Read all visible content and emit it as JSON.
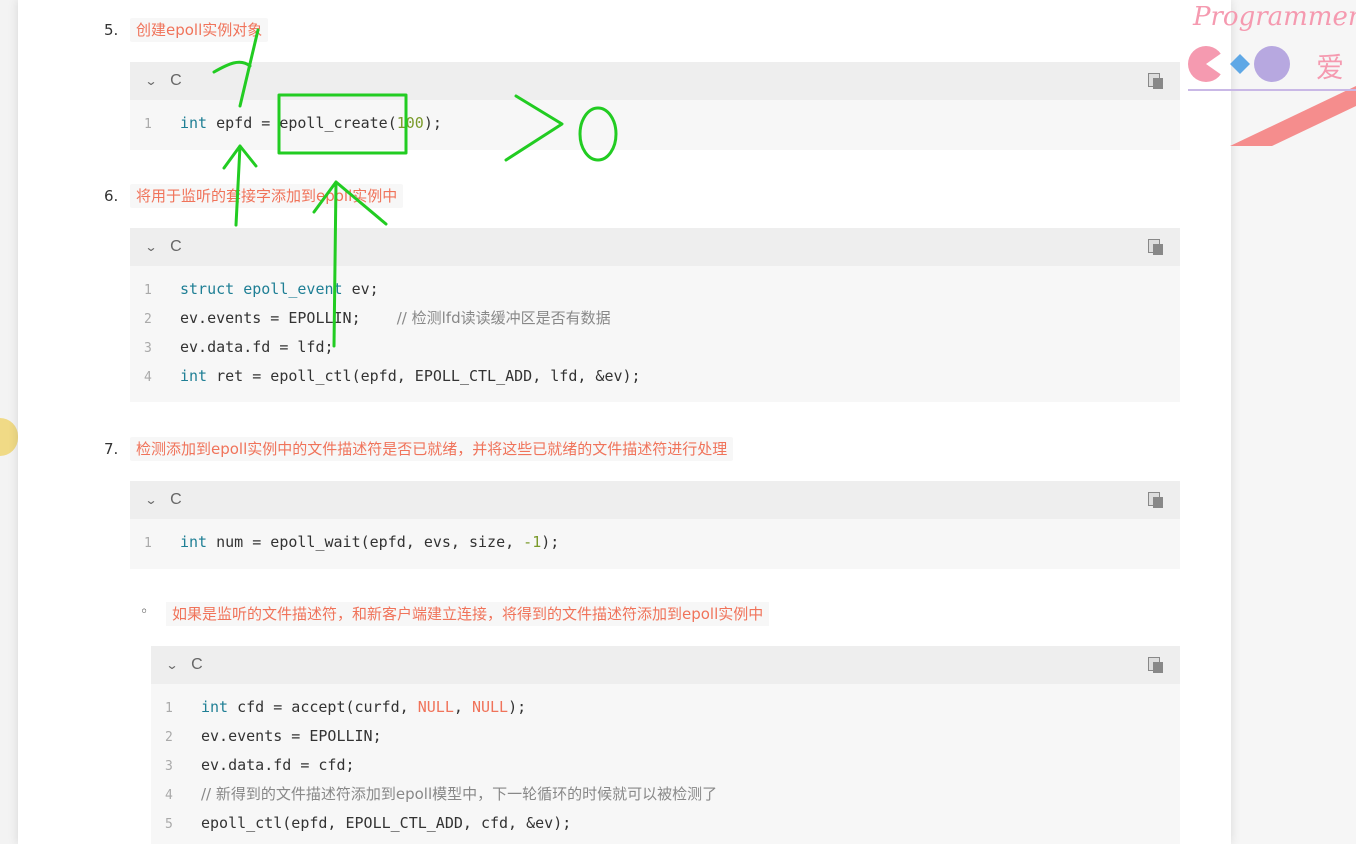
{
  "steps": [
    {
      "num": "5.",
      "label": "创建epoll实例对象"
    },
    {
      "num": "6.",
      "label": "将用于监听的套接字添加到epoll实例中"
    },
    {
      "num": "7.",
      "label": "检测添加到epoll实例中的文件描述符是否已就绪，并将这些已就绪的文件描述符进行处理"
    }
  ],
  "bullet": {
    "marker": "◦",
    "label": "如果是监听的文件描述符，和新客户端建立连接，将得到的文件描述符添加到epoll实例中"
  },
  "code_blocks": [
    {
      "language": "C",
      "lines": [
        {
          "n": "1",
          "tokens": [
            {
              "t": "int",
              "c": "kw"
            },
            {
              "t": " epfd = epoll_create(",
              "c": ""
            },
            {
              "t": "100",
              "c": "num-lit"
            },
            {
              "t": ");",
              "c": ""
            }
          ]
        }
      ]
    },
    {
      "language": "C",
      "lines": [
        {
          "n": "1",
          "tokens": [
            {
              "t": "struct",
              "c": "kw"
            },
            {
              "t": " ",
              "c": ""
            },
            {
              "t": "epoll_event",
              "c": "kw"
            },
            {
              "t": " ev;",
              "c": ""
            }
          ]
        },
        {
          "n": "2",
          "tokens": [
            {
              "t": "ev.events = EPOLLIN;    ",
              "c": ""
            },
            {
              "t": "// 检测lfd读读缓冲区是否有数据",
              "c": "cmt"
            }
          ]
        },
        {
          "n": "3",
          "tokens": [
            {
              "t": "ev.data.fd = lfd;",
              "c": ""
            }
          ]
        },
        {
          "n": "4",
          "tokens": [
            {
              "t": "int",
              "c": "kw"
            },
            {
              "t": " ret = epoll_ctl(epfd, EPOLL_CTL_ADD, lfd, &ev);",
              "c": ""
            }
          ]
        }
      ]
    },
    {
      "language": "C",
      "lines": [
        {
          "n": "1",
          "tokens": [
            {
              "t": "int",
              "c": "kw"
            },
            {
              "t": " num = epoll_wait(epfd, evs, size, ",
              "c": ""
            },
            {
              "t": "-1",
              "c": "num-lit"
            },
            {
              "t": ");",
              "c": ""
            }
          ]
        }
      ]
    },
    {
      "language": "C",
      "lines": [
        {
          "n": "1",
          "tokens": [
            {
              "t": "int",
              "c": "kw"
            },
            {
              "t": " cfd = accept(curfd, ",
              "c": ""
            },
            {
              "t": "NULL",
              "c": "null"
            },
            {
              "t": ", ",
              "c": ""
            },
            {
              "t": "NULL",
              "c": "null"
            },
            {
              "t": ");",
              "c": ""
            }
          ]
        },
        {
          "n": "2",
          "tokens": [
            {
              "t": "ev.events = EPOLLIN;",
              "c": ""
            }
          ]
        },
        {
          "n": "3",
          "tokens": [
            {
              "t": "ev.data.fd = cfd;",
              "c": ""
            }
          ]
        },
        {
          "n": "4",
          "tokens": [
            {
              "t": "// 新得到的文件描述符添加到epoll模型中，下一轮循环的时候就可以被检测了",
              "c": "cmt"
            }
          ]
        },
        {
          "n": "5",
          "tokens": [
            {
              "t": "epoll_ctl(epfd, EPOLL_CTL_ADD, cfd, &ev);",
              "c": ""
            }
          ]
        }
      ]
    }
  ],
  "logo": {
    "text": "Programmer",
    "glyph": "爱"
  },
  "annotation": {
    "text": ">0",
    "color": "#22cc22"
  },
  "icons": {
    "chevron": "chevron-down-icon",
    "copy": "copy-icon"
  },
  "colors": {
    "step_label": "#f0735a",
    "keyword": "#1f7f95",
    "number": "#7a9a2a",
    "null": "#f0735a",
    "comment": "#888888",
    "header_bg": "#eeeeee",
    "code_bg": "#f7f7f7"
  }
}
